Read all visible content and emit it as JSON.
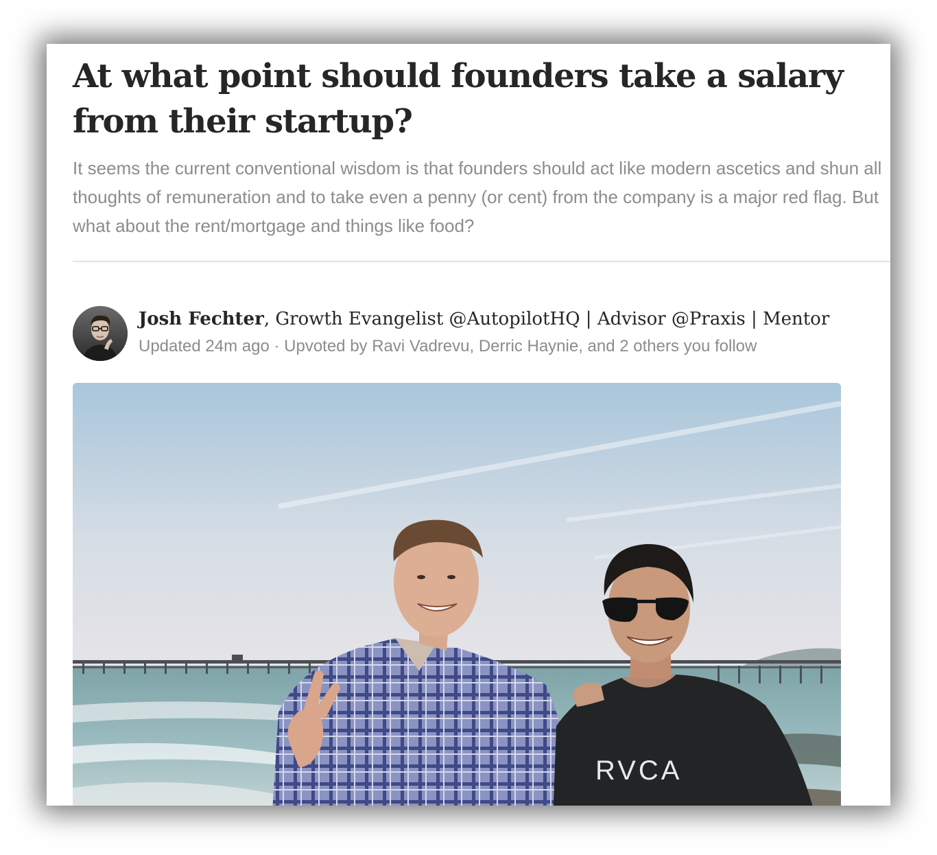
{
  "question": {
    "title": "At what point should founders take a salary from their startup?",
    "details": "It seems the current conventional wisdom is that founders should act like modern ascetics and shun all thoughts of remuneration and to take even a penny (or cent) from the company is a major red flag. But what about the rent/mortgage and things like food?"
  },
  "answer": {
    "author_name": "Josh Fechter",
    "author_credential": ", Growth Evangelist @AutopilotHQ | Advisor @Praxis | Mentor",
    "meta": "Updated 24m ago · Upvoted by Ravi Vadrevu, Derric Haynie, and 2 others you follow",
    "photo": {
      "shirt_logo": "RVCA"
    }
  },
  "colors": {
    "title": "#262626",
    "muted": "#8c8c8c",
    "divider": "#e2e2e2"
  }
}
